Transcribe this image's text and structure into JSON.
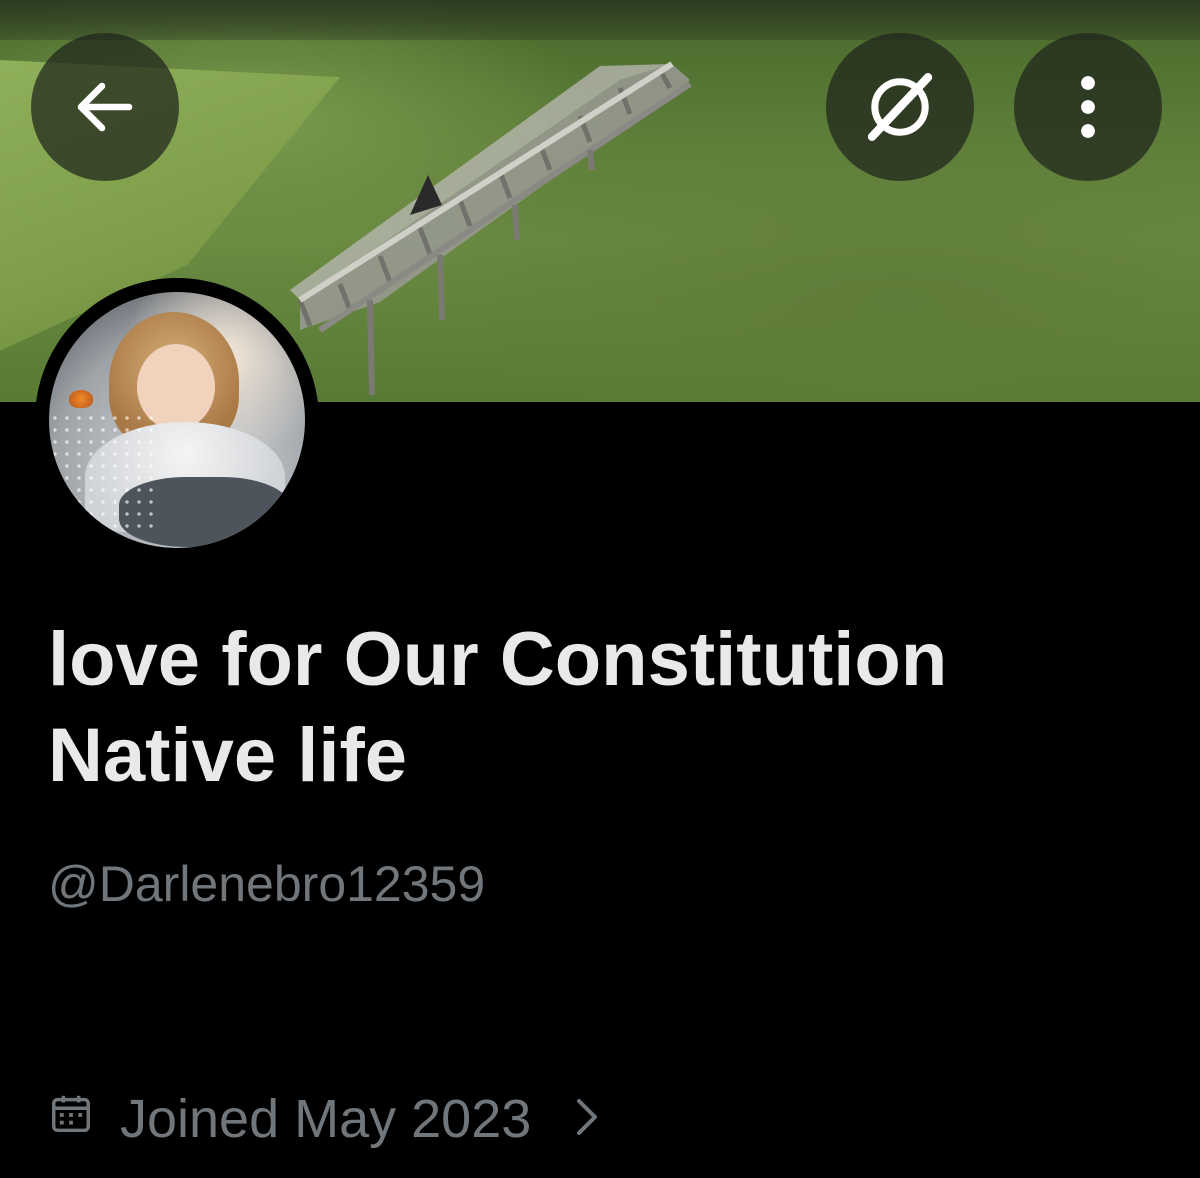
{
  "header": {
    "back_icon": "arrow-left-icon",
    "grok_icon": "grok-slash-icon",
    "more_icon": "vertical-dots-icon",
    "button_bg": "#1e241c"
  },
  "profile": {
    "display_name": "love for Our Constitution Native life",
    "handle": "@Darlenebro12359",
    "joined_text": "Joined May 2023",
    "joined_icon": "calendar-icon",
    "joined_chevron": "chevron-right-icon"
  },
  "colors": {
    "background": "#000000",
    "primary_text": "#e7e9ea",
    "secondary_text": "#71767b"
  }
}
